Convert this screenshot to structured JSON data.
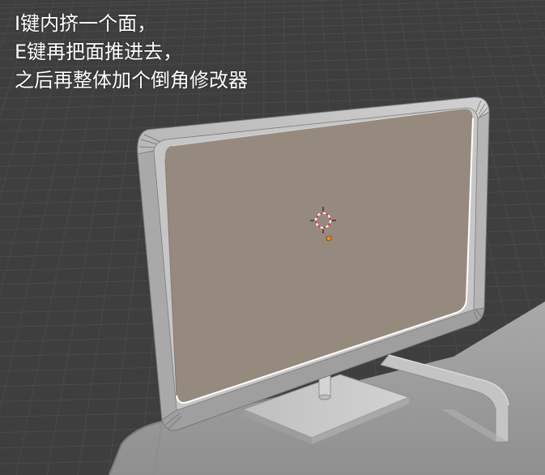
{
  "caption": {
    "line1": "I键内挤一个面，",
    "line2": "E键再把面推进去，",
    "line3": "之后再整体加个倒角修改器"
  },
  "viewport": {
    "background": "#3e3e3e",
    "grid_color": "#4a4a4a",
    "mesh_light": "#bdbdbd",
    "mesh_mid": "#9a9a9a",
    "mesh_dark": "#6e6e6e",
    "screen_face": "#968a7e",
    "highlight_edge": "#ffffff",
    "origin_color": "#ff8c1a",
    "cursor_color": "#e8323c"
  }
}
